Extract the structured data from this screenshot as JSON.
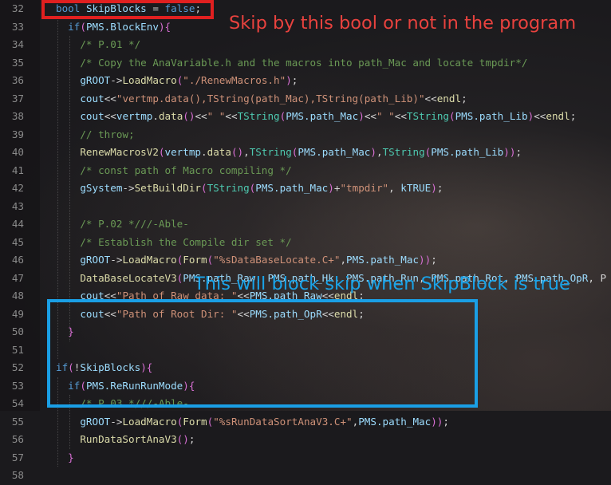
{
  "colors": {
    "keyword": "#569cd6",
    "function": "#dcdcaa",
    "string": "#ce9178",
    "comment": "#6a9955",
    "variable": "#9cdcfe",
    "type": "#4ec9b0",
    "bracket": "#da70d6",
    "default": "#d4d4d4",
    "red_annotation": "#e8423e",
    "blue_annotation": "#1aa3e8"
  },
  "annotations": {
    "red": "Skip by this bool or not in the program",
    "blue": "This will block skip when SkipBlock is true"
  },
  "lines": [
    {
      "num": "32",
      "tokens": [
        [
          "bool",
          "keyword"
        ],
        [
          " ",
          "default"
        ],
        [
          "SkipBlocks",
          "variable"
        ],
        [
          " = ",
          "default"
        ],
        [
          "false",
          "keyword"
        ],
        [
          ";",
          "default"
        ]
      ]
    },
    {
      "num": "33",
      "tokens": [
        [
          "  ",
          "default"
        ],
        [
          "if",
          "keyword"
        ],
        [
          "(",
          "bracket"
        ],
        [
          "PMS.BlockEnv",
          "variable"
        ],
        [
          ")",
          "bracket"
        ],
        [
          "{",
          "bracket"
        ]
      ]
    },
    {
      "num": "34",
      "tokens": [
        [
          "    ",
          "default"
        ],
        [
          "/* P.01 */",
          "comment"
        ]
      ]
    },
    {
      "num": "35",
      "tokens": [
        [
          "    ",
          "default"
        ],
        [
          "/* Copy the AnaVariable.h and the macros into path_Mac and locate tmpdir*/",
          "comment"
        ]
      ]
    },
    {
      "num": "36",
      "tokens": [
        [
          "    ",
          "default"
        ],
        [
          "gROOT",
          "variable"
        ],
        [
          "->",
          "default"
        ],
        [
          "LoadMacro",
          "function"
        ],
        [
          "(",
          "bracket"
        ],
        [
          "\"./RenewMacros.h\"",
          "string"
        ],
        [
          ")",
          "bracket"
        ],
        [
          ";",
          "default"
        ]
      ]
    },
    {
      "num": "37",
      "tokens": [
        [
          "    ",
          "default"
        ],
        [
          "cout",
          "variable"
        ],
        [
          "<<",
          "default"
        ],
        [
          "\"vertmp.data(),TString(path_Mac),TString(path_Lib)\"",
          "string"
        ],
        [
          "<<",
          "default"
        ],
        [
          "endl",
          "function"
        ],
        [
          ";",
          "default"
        ]
      ]
    },
    {
      "num": "38",
      "tokens": [
        [
          "    ",
          "default"
        ],
        [
          "cout",
          "variable"
        ],
        [
          "<<",
          "default"
        ],
        [
          "vertmp",
          "variable"
        ],
        [
          ".",
          "default"
        ],
        [
          "data",
          "function"
        ],
        [
          "()",
          "bracket"
        ],
        [
          "<<",
          "default"
        ],
        [
          "\" \"",
          "string"
        ],
        [
          "<<",
          "default"
        ],
        [
          "TString",
          "type"
        ],
        [
          "(",
          "bracket"
        ],
        [
          "PMS.path_Mac",
          "variable"
        ],
        [
          ")",
          "bracket"
        ],
        [
          "<<",
          "default"
        ],
        [
          "\" \"",
          "string"
        ],
        [
          "<<",
          "default"
        ],
        [
          "TString",
          "type"
        ],
        [
          "(",
          "bracket"
        ],
        [
          "PMS.path_Lib",
          "variable"
        ],
        [
          ")",
          "bracket"
        ],
        [
          "<<",
          "default"
        ],
        [
          "endl",
          "function"
        ],
        [
          ";",
          "default"
        ]
      ]
    },
    {
      "num": "39",
      "tokens": [
        [
          "    ",
          "default"
        ],
        [
          "// throw;",
          "comment"
        ]
      ]
    },
    {
      "num": "40",
      "tokens": [
        [
          "    ",
          "default"
        ],
        [
          "RenewMacrosV2",
          "function"
        ],
        [
          "(",
          "bracket"
        ],
        [
          "vertmp",
          "variable"
        ],
        [
          ".",
          "default"
        ],
        [
          "data",
          "function"
        ],
        [
          "()",
          "bracket"
        ],
        [
          ",",
          "default"
        ],
        [
          "TString",
          "type"
        ],
        [
          "(",
          "bracket"
        ],
        [
          "PMS.path_Mac",
          "variable"
        ],
        [
          ")",
          "bracket"
        ],
        [
          ",",
          "default"
        ],
        [
          "TString",
          "type"
        ],
        [
          "(",
          "bracket"
        ],
        [
          "PMS.path_Lib",
          "variable"
        ],
        [
          ")",
          "bracket"
        ],
        [
          ")",
          "bracket"
        ],
        [
          ";",
          "default"
        ]
      ]
    },
    {
      "num": "41",
      "tokens": [
        [
          "    ",
          "default"
        ],
        [
          "/* const path of Macro compiling */",
          "comment"
        ]
      ]
    },
    {
      "num": "42",
      "tokens": [
        [
          "    ",
          "default"
        ],
        [
          "gSystem",
          "variable"
        ],
        [
          "->",
          "default"
        ],
        [
          "SetBuildDir",
          "function"
        ],
        [
          "(",
          "bracket"
        ],
        [
          "TString",
          "type"
        ],
        [
          "(",
          "bracket"
        ],
        [
          "PMS.path_Mac",
          "variable"
        ],
        [
          ")",
          "bracket"
        ],
        [
          "+",
          "default"
        ],
        [
          "\"tmpdir\"",
          "string"
        ],
        [
          ", ",
          "default"
        ],
        [
          "kTRUE",
          "variable"
        ],
        [
          ")",
          "bracket"
        ],
        [
          ";",
          "default"
        ]
      ]
    },
    {
      "num": "43",
      "tokens": []
    },
    {
      "num": "44",
      "tokens": [
        [
          "    ",
          "default"
        ],
        [
          "/* P.02 *///-Able-",
          "comment"
        ]
      ]
    },
    {
      "num": "45",
      "tokens": [
        [
          "    ",
          "default"
        ],
        [
          "/* Establish the Compile dir set */",
          "comment"
        ]
      ]
    },
    {
      "num": "46",
      "tokens": [
        [
          "    ",
          "default"
        ],
        [
          "gROOT",
          "variable"
        ],
        [
          "->",
          "default"
        ],
        [
          "LoadMacro",
          "function"
        ],
        [
          "(",
          "bracket"
        ],
        [
          "Form",
          "function"
        ],
        [
          "(",
          "bracket"
        ],
        [
          "\"%sDataBaseLocate.C+\"",
          "string"
        ],
        [
          ",",
          "default"
        ],
        [
          "PMS.path_Mac",
          "variable"
        ],
        [
          ")",
          "bracket"
        ],
        [
          ")",
          "bracket"
        ],
        [
          ";",
          "default"
        ]
      ]
    },
    {
      "num": "47",
      "tokens": [
        [
          "    ",
          "default"
        ],
        [
          "DataBaseLocateV3",
          "function"
        ],
        [
          "(",
          "bracket"
        ],
        [
          "PMS.path_Raw",
          "variable"
        ],
        [
          ", ",
          "default"
        ],
        [
          "PMS.path_Hk",
          "variable"
        ],
        [
          ", ",
          "default"
        ],
        [
          "PMS.path_Run",
          "variable"
        ],
        [
          ", ",
          "default"
        ],
        [
          "PMS.path_Rot",
          "variable"
        ],
        [
          ", ",
          "default"
        ],
        [
          "PMS.path_OpR",
          "variable"
        ],
        [
          ", P",
          "default"
        ]
      ]
    },
    {
      "num": "48",
      "tokens": [
        [
          "    ",
          "default"
        ],
        [
          "cout",
          "variable"
        ],
        [
          "<<",
          "default"
        ],
        [
          "\"Path of Raw data: \"",
          "string"
        ],
        [
          "<<",
          "default"
        ],
        [
          "PMS.path_Raw",
          "variable"
        ],
        [
          "<<",
          "default"
        ],
        [
          "endl",
          "function"
        ],
        [
          ";",
          "default"
        ]
      ]
    },
    {
      "num": "49",
      "tokens": [
        [
          "    ",
          "default"
        ],
        [
          "cout",
          "variable"
        ],
        [
          "<<",
          "default"
        ],
        [
          "\"Path of Root Dir: \"",
          "string"
        ],
        [
          "<<",
          "default"
        ],
        [
          "PMS.path_OpR",
          "variable"
        ],
        [
          "<<",
          "default"
        ],
        [
          "endl",
          "function"
        ],
        [
          ";",
          "default"
        ]
      ]
    },
    {
      "num": "50",
      "tokens": [
        [
          "  ",
          "default"
        ],
        [
          "}",
          "bracket"
        ]
      ]
    },
    {
      "num": "51",
      "tokens": []
    },
    {
      "num": "52",
      "tokens": [
        [
          "if",
          "keyword"
        ],
        [
          "(",
          "bracket"
        ],
        [
          "!",
          "default"
        ],
        [
          "SkipBlocks",
          "variable"
        ],
        [
          ")",
          "bracket"
        ],
        [
          "{",
          "bracket"
        ]
      ]
    },
    {
      "num": "53",
      "tokens": [
        [
          "  ",
          "default"
        ],
        [
          "if",
          "keyword"
        ],
        [
          "(",
          "bracket"
        ],
        [
          "PMS.ReRunRunMode",
          "variable"
        ],
        [
          ")",
          "bracket"
        ],
        [
          "{",
          "bracket"
        ]
      ]
    },
    {
      "num": "54",
      "tokens": [
        [
          "    ",
          "default"
        ],
        [
          "/* P.03 *///-Able-",
          "comment"
        ]
      ]
    },
    {
      "num": "55",
      "tokens": [
        [
          "    ",
          "default"
        ],
        [
          "gROOT",
          "variable"
        ],
        [
          "->",
          "default"
        ],
        [
          "LoadMacro",
          "function"
        ],
        [
          "(",
          "bracket"
        ],
        [
          "Form",
          "function"
        ],
        [
          "(",
          "bracket"
        ],
        [
          "\"%sRunDataSortAnaV3.C+\"",
          "string"
        ],
        [
          ",",
          "default"
        ],
        [
          "PMS.path_Mac",
          "variable"
        ],
        [
          ")",
          "bracket"
        ],
        [
          ")",
          "bracket"
        ],
        [
          ";",
          "default"
        ]
      ]
    },
    {
      "num": "56",
      "tokens": [
        [
          "    ",
          "default"
        ],
        [
          "RunDataSortAnaV3",
          "function"
        ],
        [
          "()",
          "bracket"
        ],
        [
          ";",
          "default"
        ]
      ]
    },
    {
      "num": "57",
      "tokens": [
        [
          "  ",
          "default"
        ],
        [
          "}",
          "bracket"
        ]
      ]
    },
    {
      "num": "58",
      "tokens": []
    }
  ]
}
